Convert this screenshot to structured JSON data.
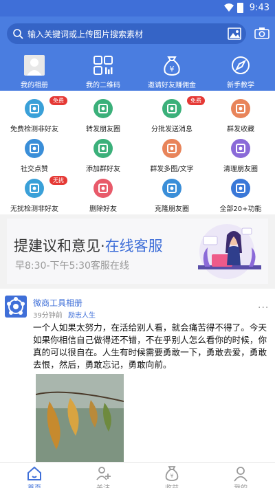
{
  "status_bar": {
    "time": "9:43"
  },
  "search": {
    "placeholder": "输入关键词或上传图片搜索素材"
  },
  "top_nav": [
    {
      "label": "我的相册",
      "icon": "avatar"
    },
    {
      "label": "我的二维码",
      "icon": "qrcode-icon"
    },
    {
      "label": "邀请好友赚佣金",
      "icon": "money-bag-icon"
    },
    {
      "label": "新手教学",
      "icon": "compass-icon"
    }
  ],
  "grid": [
    {
      "label": "免费检测非好友",
      "badge": "免费",
      "color": "#3aa0d8"
    },
    {
      "label": "转发朋友圈",
      "badge": "",
      "color": "#3bb07a"
    },
    {
      "label": "分批发送消息",
      "badge": "免费",
      "color": "#3bb07a"
    },
    {
      "label": "群发收藏",
      "badge": "",
      "color": "#e8845a"
    },
    {
      "label": "社交点赞",
      "badge": "",
      "color": "#3a8ed8"
    },
    {
      "label": "添加群好友",
      "badge": "",
      "color": "#3bb07a"
    },
    {
      "label": "群发多图/文字",
      "badge": "",
      "color": "#e8845a"
    },
    {
      "label": "清理朋友圈",
      "badge": "",
      "color": "#8a6ad8"
    },
    {
      "label": "无扰检测非好友",
      "badge": "无扰",
      "color": "#3aa0d8"
    },
    {
      "label": "删除好友",
      "badge": "",
      "color": "#e85a6a"
    },
    {
      "label": "克隆朋友圈",
      "badge": "",
      "color": "#3a8ed8"
    },
    {
      "label": "全部20+功能",
      "badge": "",
      "color": "#3a78d8"
    }
  ],
  "banner": {
    "title_main": "提建议和意见·",
    "title_highlight": "在线客服",
    "subtitle": "早8:30-下午5:30客服在线"
  },
  "post": {
    "author": "微商工具相册",
    "time": "39分钟前",
    "tag": "励志人生",
    "more": "···",
    "text": "一个人如果太努力，在活给别人看，就会痛苦得不得了。今天如果你相信自己做得还不错，不在乎别人怎么看你的时候，你真的可以很自在。人生有时候需要勇敢一下，勇敢去爱，勇敢去恨，然后，勇敢忘记，勇敢向前。"
  },
  "tabs": [
    {
      "label": "首页",
      "icon": "home-icon",
      "active": true
    },
    {
      "label": "关注",
      "icon": "follow-icon",
      "active": false
    },
    {
      "label": "收益",
      "icon": "earnings-icon",
      "active": false
    },
    {
      "label": "我的",
      "icon": "profile-icon",
      "active": false
    }
  ],
  "colors": {
    "brand": "#3f6fd8",
    "header": "#4a7de0",
    "badge": "#e53935"
  }
}
